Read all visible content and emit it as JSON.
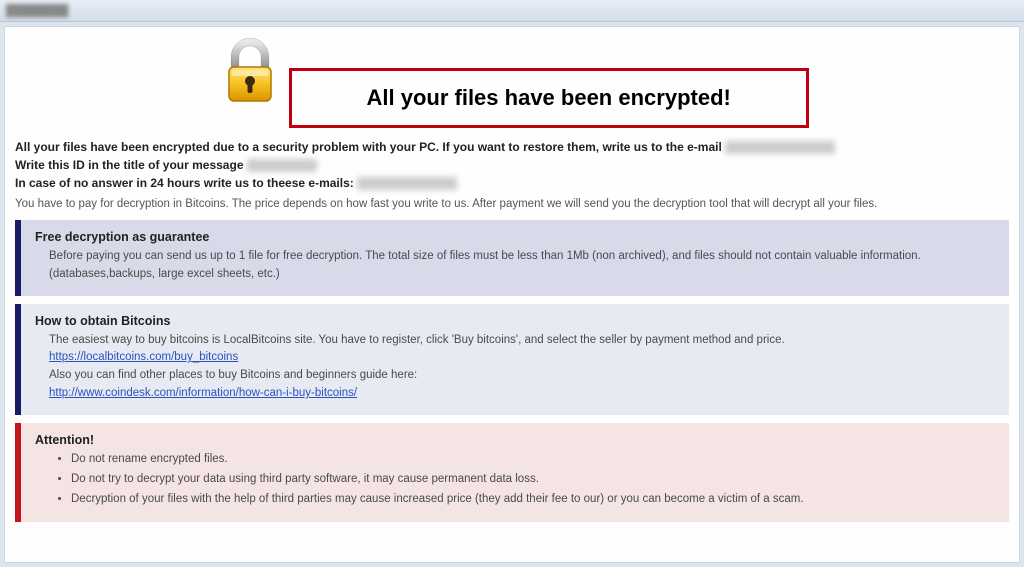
{
  "titlebar": {
    "text": "████████"
  },
  "header": {
    "headline": "All your files have been encrypted!"
  },
  "intro": {
    "line1_bold": "All your files have been encrypted due to a security problem with your PC. If you want to restore them, write us to the e-mail",
    "line2_bold": "Write this ID in the title of your message",
    "line3_bold": "In case of no answer in 24 hours write us to theese e-mails:",
    "payline": "You have to pay for decryption in Bitcoins. The price depends on how fast you write to us. After payment we will send you the decryption tool that will decrypt all your files."
  },
  "panels": {
    "guarantee": {
      "title": "Free decryption as guarantee",
      "body": "Before paying you can send us up to 1 file for free decryption. The total size of files must be less than 1Mb (non archived), and files should not contain valuable information. (databases,backups, large excel sheets, etc.)"
    },
    "bitcoins": {
      "title": "How to obtain Bitcoins",
      "line1": "The easiest way to buy bitcoins is LocalBitcoins site. You have to register, click 'Buy bitcoins', and select the seller by payment method and price.",
      "link1": "https://localbitcoins.com/buy_bitcoins",
      "line2": "Also you can find other places to buy Bitcoins and beginners guide here:",
      "link2": "http://www.coindesk.com/information/how-can-i-buy-bitcoins/"
    },
    "attention": {
      "title": "Attention!",
      "items": [
        "Do not rename encrypted files.",
        "Do not try to decrypt your data using third party software, it may cause permanent data loss.",
        "Decryption of your files with the help of third parties may cause increased price (they add their fee to our) or you can become a victim of a scam."
      ]
    }
  }
}
